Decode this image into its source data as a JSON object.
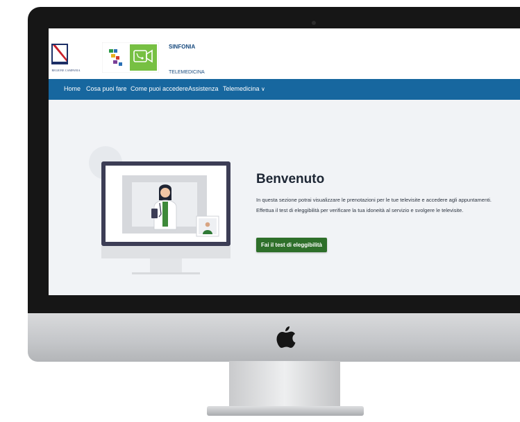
{
  "header": {
    "region_logo_text": "REGIONE CAMPANIA",
    "brand_title": "SINFONIA",
    "brand_subtitle": "TELEMEDICINA"
  },
  "nav": {
    "items": [
      {
        "label": "Home"
      },
      {
        "label": "Cosa puoi fare"
      },
      {
        "label": "Come puoi accedere"
      },
      {
        "label": "Assistenza"
      },
      {
        "label": "Telemedicina",
        "icon": "chevron-down-icon"
      }
    ],
    "chevron": "∨"
  },
  "hero": {
    "title": "Benvenuto",
    "line1": "In questa sezione potrai visualizzare le prenotazioni per le tue televisite e accedere agli appuntamenti.",
    "line2": "Effettua il test di eleggibilità per verificare la tua idoneità al servizio e svolgere le televisite.",
    "cta_label": "Fai il test di eleggibilità",
    "illustration_icon": "doctor-video-call-icon"
  },
  "colors": {
    "nav_bg": "#17679f",
    "brand_text": "#174a7e",
    "cta_bg": "#2e6f2a",
    "page_bg": "#f1f3f6"
  }
}
